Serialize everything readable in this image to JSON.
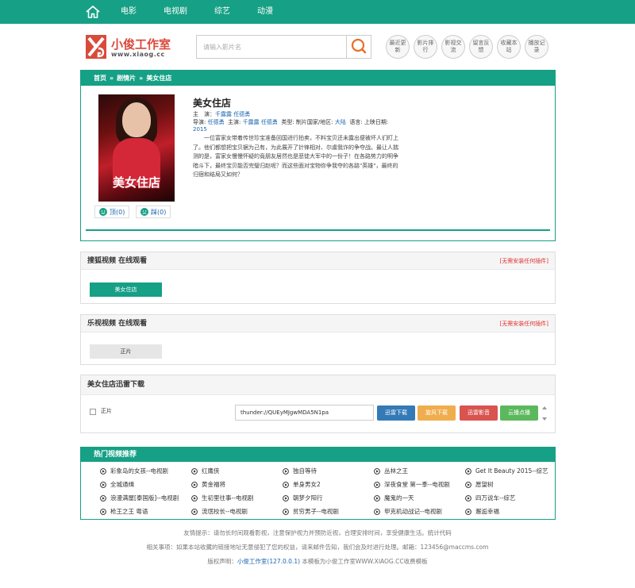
{
  "nav": {
    "items": [
      {
        "label": "电影"
      },
      {
        "label": "电视剧"
      },
      {
        "label": "综艺"
      },
      {
        "label": "动漫"
      }
    ]
  },
  "header": {
    "logo_title": "小俊工作室",
    "logo_sub": "www.xiaog.cc",
    "search_placeholder": "请输入影片名",
    "quick_buttons": [
      "最近更新",
      "影片排行",
      "影视交流",
      "留言反馈",
      "收藏本站",
      "播放记录"
    ]
  },
  "breadcrumb": [
    "首页",
    "剧情片",
    "美女住店"
  ],
  "movie": {
    "title": "美女住店",
    "starring_label": "主　演：",
    "starring": [
      "千露露",
      "任德勇"
    ],
    "director_label": "导演:",
    "director": "任德勇",
    "cast_label": "主演:",
    "cast": [
      "千露露",
      "任德勇"
    ],
    "type_label": "类型: 制片国家/地区:",
    "region": "大陆",
    "lang_label": "语言: 上映日期:",
    "year": "2015",
    "description": "一位富家女带着传世珍宝准备回国进行拍卖，不料宝贝还未露出便被坏人们盯上了。他们都想把宝贝据为己有，为此展开了针锋相对、尔虞我诈的争夺战。最让人揣测的是，富家女慢慢怀疑的竟朋友居然也是恶徒大军中的一份子！在各路势力的明争暗斗下，最终宝贝能否完璧归赵呢？而这些面对宝物你争我夺的各路\"英雄\"，最终的归宿和结局又如何？",
    "poster_text": "美女住店",
    "up_label": "顶(0)",
    "down_label": "踩(0)"
  },
  "sources": [
    {
      "title": "搜狐视频 在线观看",
      "note": "[无需安装任何插件]",
      "episode": "美女住店"
    },
    {
      "title": "乐视视频 在线观看",
      "note": "[无需安装任何插件]",
      "episode": "正片"
    }
  ],
  "download": {
    "title": "美女住店迅雷下载",
    "item_label": "正片",
    "link": "thunder://QUEyMJgwMDA5N1pa",
    "buttons": [
      {
        "label": "迅雷下载",
        "color": "#337ab7"
      },
      {
        "label": "旋风下载",
        "color": "#f0ad4e"
      },
      {
        "label": "迅雷影音",
        "color": "#d9534f"
      },
      {
        "label": "云播点播",
        "color": "#5cb85c"
      }
    ]
  },
  "recommend": {
    "title": "热门视频推荐",
    "items": [
      "彩象岛的女孩--电视剧",
      "红鹰侠",
      "独自等待",
      "丛林之王",
      "Get It Beauty 2015--综艺",
      "全城通缉",
      "黄金福将",
      "单身男女2",
      "深夜食堂 第一季--电视剧",
      "愿望树",
      "浪漫满屋[泰国版]--电视剧",
      "生初里往事--电视剧",
      "朝梦夕阳行",
      "魔鬼的一天",
      "四万说车--综艺",
      "枪王之王 粤语",
      "流氓校长--电视剧",
      "贫穷男子--电视剧",
      "甲克机动战记--电视剧",
      "邂逅幸福"
    ]
  },
  "footer": {
    "tip": "友情提示：请勿长时间观看影视，注意保护视力并预防近视，合理安排时间，享受健康生活。统计代码",
    "notice": "相关事项：如果本站收藏的链接地址无意侵犯了您的权益，请来邮件告知，我们会及时进行处理。邮箱：123456@maccms.com",
    "copyright_prefix": "版权声明：",
    "copyright_link": "小俊工作室(127.0.0.1)",
    "copyright_suffix": " 本模板为小俊工作室WWW.XIAOG.CC收费模板"
  },
  "colors": {
    "accent": "#16a085",
    "link": "#1a64b0",
    "warning": "#e03030"
  }
}
